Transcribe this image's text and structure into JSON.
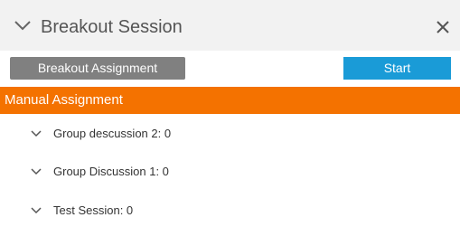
{
  "panel": {
    "title": "Breakout Session",
    "collapse_icon": "chevron-down-icon",
    "close_icon": "close-icon"
  },
  "toolbar": {
    "assignment_label": "Breakout Assignment",
    "start_label": "Start"
  },
  "manual_assignment": {
    "label": "Manual Assignment"
  },
  "groups": [
    {
      "label": "Group descussion 2: 0"
    },
    {
      "label": "Group Discussion 1: 0"
    },
    {
      "label": "Test Session: 0"
    }
  ],
  "colors": {
    "header_bg": "#f2f2f2",
    "assignment_button": "#808080",
    "start_button": "#1a9bd7",
    "manual_bar": "#f47200"
  }
}
